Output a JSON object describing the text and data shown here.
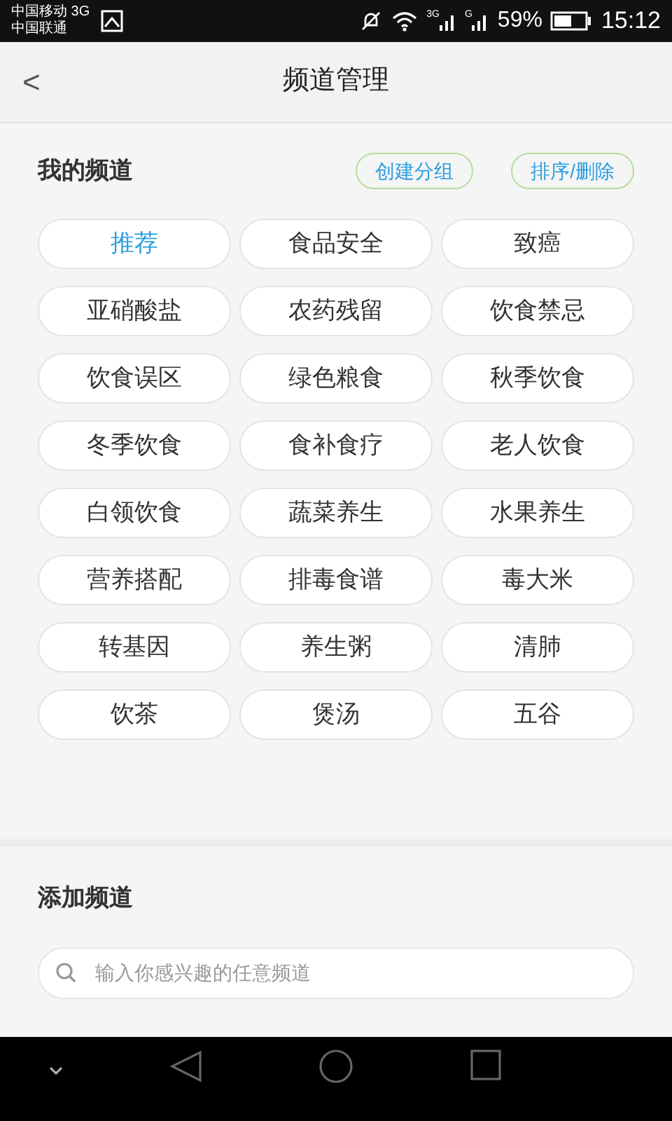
{
  "status_bar": {
    "carrier_1": "中国移动 3G",
    "carrier_2": "中国联通",
    "signal_1_label": "3G",
    "signal_2_label": "G",
    "battery": "59%",
    "time": "15:12"
  },
  "header": {
    "back": "<",
    "title": "频道管理"
  },
  "my_channels": {
    "title": "我的频道",
    "actions": [
      "创建分组",
      "排序/删除"
    ],
    "channels": [
      {
        "label": "推荐",
        "selected": true
      },
      {
        "label": "食品安全",
        "selected": false
      },
      {
        "label": "致癌",
        "selected": false
      },
      {
        "label": "亚硝酸盐",
        "selected": false
      },
      {
        "label": "农药残留",
        "selected": false
      },
      {
        "label": "饮食禁忌",
        "selected": false
      },
      {
        "label": "饮食误区",
        "selected": false
      },
      {
        "label": "绿色粮食",
        "selected": false
      },
      {
        "label": "秋季饮食",
        "selected": false
      },
      {
        "label": "冬季饮食",
        "selected": false
      },
      {
        "label": "食补食疗",
        "selected": false
      },
      {
        "label": "老人饮食",
        "selected": false
      },
      {
        "label": "白领饮食",
        "selected": false
      },
      {
        "label": "蔬菜养生",
        "selected": false
      },
      {
        "label": "水果养生",
        "selected": false
      },
      {
        "label": "营养搭配",
        "selected": false
      },
      {
        "label": "排毒食谱",
        "selected": false
      },
      {
        "label": "毒大米",
        "selected": false
      },
      {
        "label": "转基因",
        "selected": false
      },
      {
        "label": "养生粥",
        "selected": false
      },
      {
        "label": "清肺",
        "selected": false
      },
      {
        "label": "饮茶",
        "selected": false
      },
      {
        "label": "煲汤",
        "selected": false
      },
      {
        "label": "五谷",
        "selected": false
      }
    ]
  },
  "add_channel": {
    "title": "添加频道",
    "search": {
      "placeholder": "输入你感兴趣的任意频道"
    }
  }
}
